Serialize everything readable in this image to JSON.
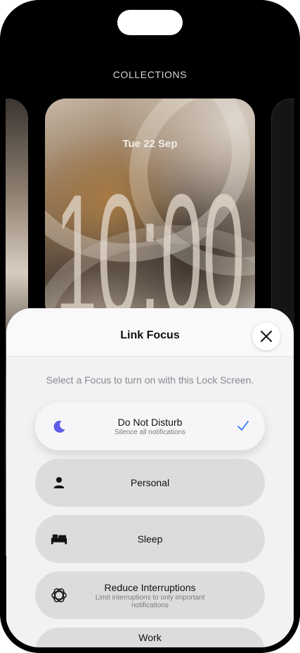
{
  "header": {
    "collections_label": "COLLECTIONS"
  },
  "lock_screen": {
    "date": "Tue 22 Sep",
    "time": "10:00"
  },
  "sheet": {
    "title": "Link Focus",
    "subtitle": "Select a Focus to turn on with this Lock Screen.",
    "focus_options": [
      {
        "label": "Do Not Disturb",
        "sub": "Silence all notifications",
        "icon": "moon-icon",
        "selected": true
      },
      {
        "label": "Personal",
        "sub": "",
        "icon": "person-icon",
        "selected": false
      },
      {
        "label": "Sleep",
        "sub": "",
        "icon": "bed-icon",
        "selected": false
      },
      {
        "label": "Reduce Interruptions",
        "sub": "Limit interruptions to only important notifications",
        "icon": "flower-icon",
        "selected": false
      },
      {
        "label": "Work",
        "sub": "",
        "icon": "badge-icon",
        "selected": false
      }
    ]
  },
  "colors": {
    "accent": "#3478f6",
    "moon": "#5e5ce6",
    "sheet_bg": "#f2f2f4",
    "row_bg": "#dcdcdc"
  }
}
